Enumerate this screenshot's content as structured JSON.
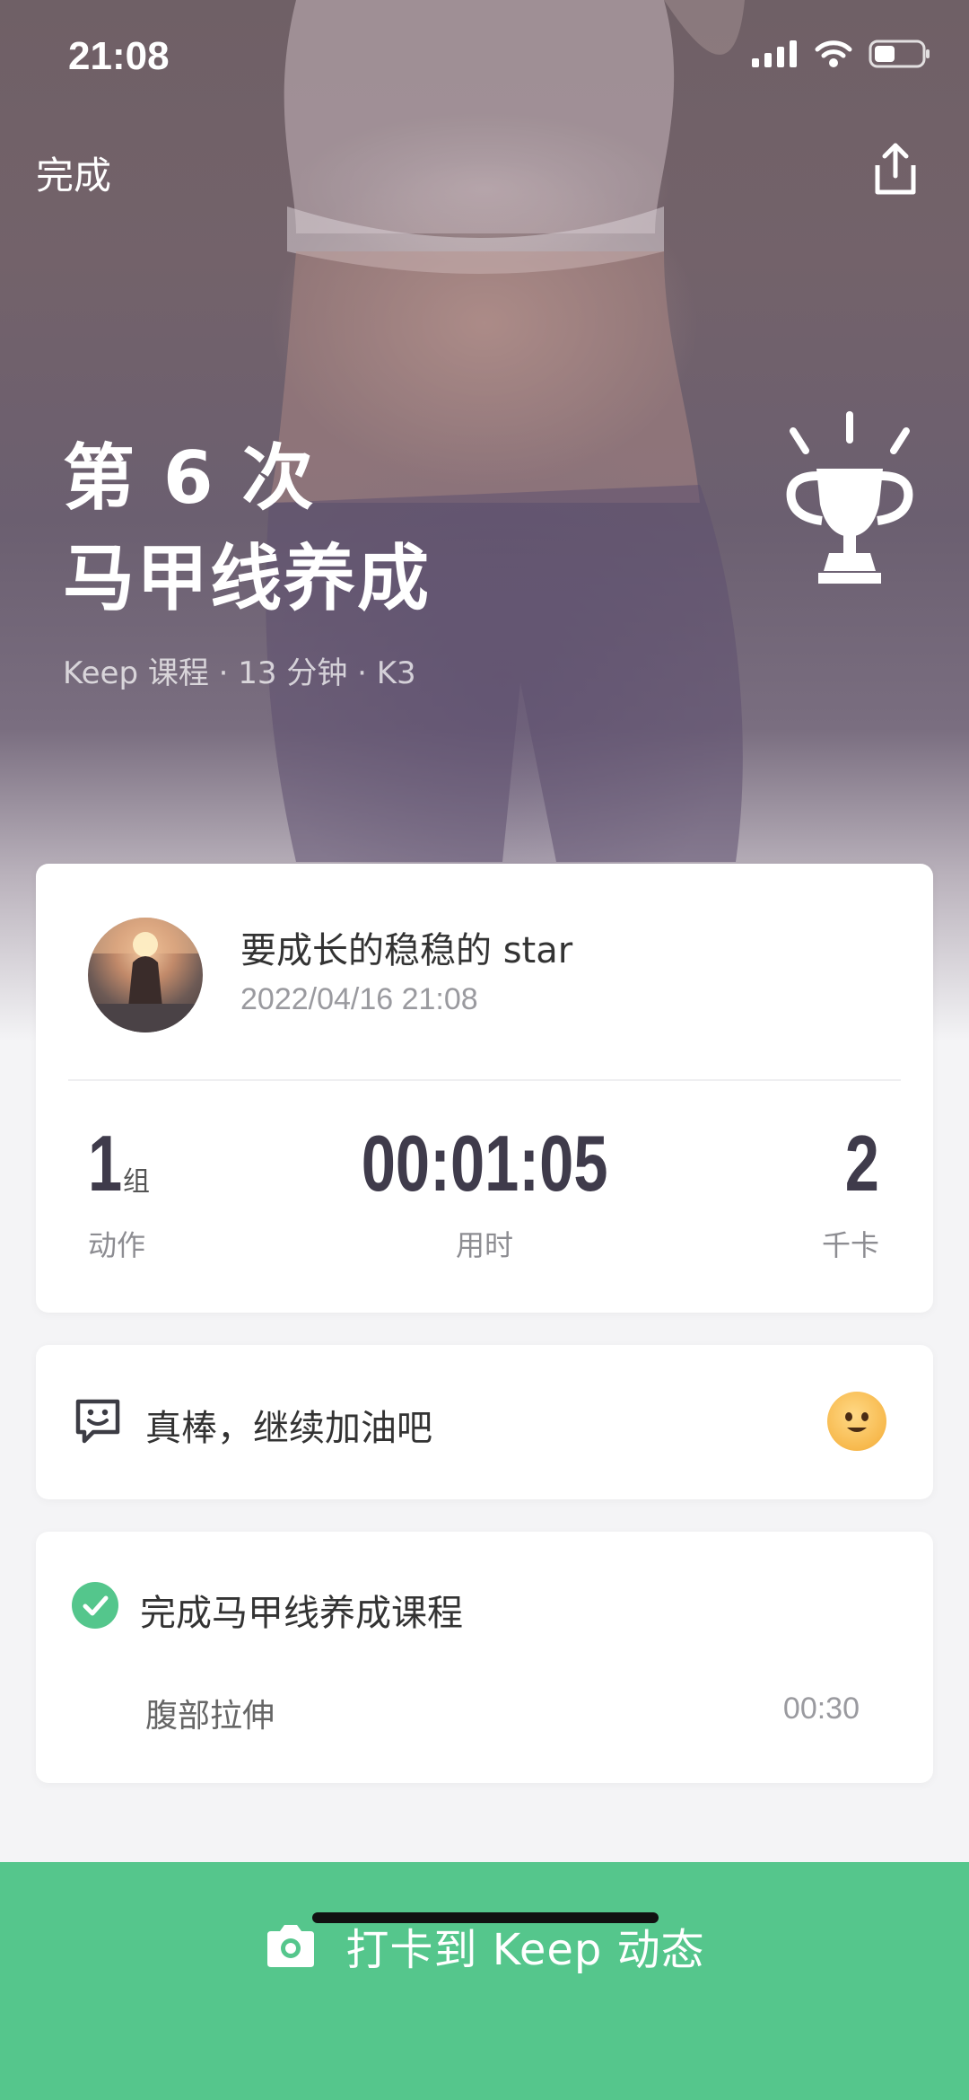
{
  "status_bar": {
    "time": "21:08"
  },
  "nav": {
    "done_label": "完成"
  },
  "hero": {
    "count_text": "第 6 次",
    "course_title": "马甲线养成",
    "meta": "Keep 课程 · 13 分钟 · K3"
  },
  "user": {
    "name": "要成长的稳稳的 star",
    "datetime": "2022/04/16 21:08"
  },
  "stats": {
    "sets_value": "1",
    "sets_unit": "组",
    "sets_label": "动作",
    "time_value": "00:01:05",
    "time_label": "用时",
    "kcal_value": "2",
    "kcal_label": "千卡"
  },
  "cheer": {
    "text": "真棒，继续加油吧"
  },
  "course": {
    "completed_title": "完成马甲线养成课程",
    "items": [
      {
        "name": "腹部拉伸",
        "duration": "00:30"
      }
    ]
  },
  "action": {
    "checkin_label": "打卡到 Keep 动态"
  },
  "colors": {
    "accent_green": "#55c68c",
    "stat_text": "#3f3b4b"
  }
}
